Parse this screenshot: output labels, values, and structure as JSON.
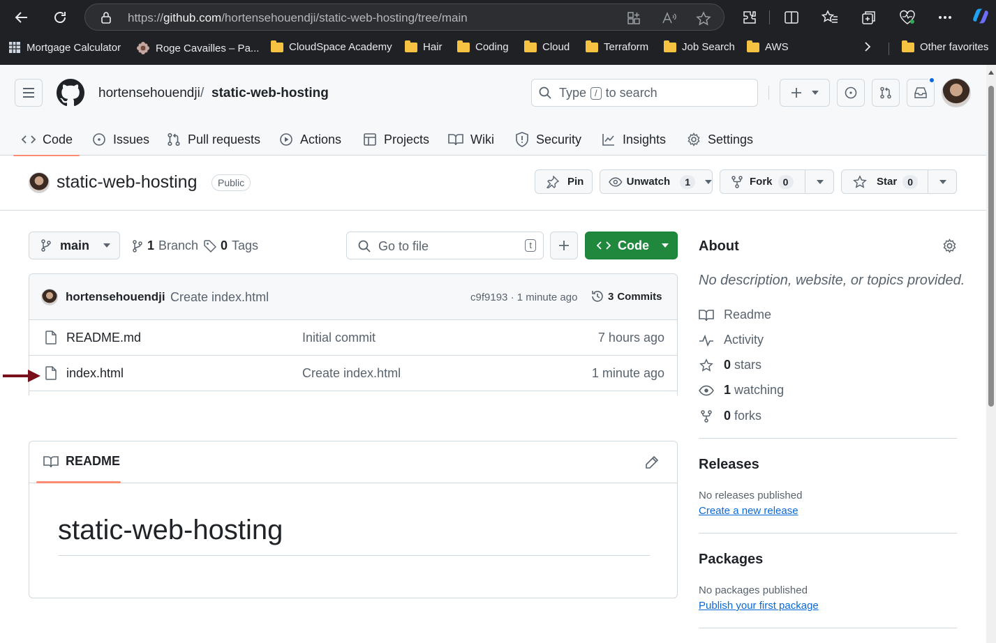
{
  "browser": {
    "url_prefix": "https://",
    "url_host": "github.com",
    "url_path": "/hortensehouendji/static-web-hosting/tree/main",
    "bookmarks": [
      {
        "label": "Mortgage Calculator",
        "icon": "grid-icon"
      },
      {
        "label": "Roge Cavailles – Pa...",
        "icon": "flower-icon"
      },
      {
        "label": "CloudSpace Academy",
        "icon": "folder-icon"
      },
      {
        "label": "Hair",
        "icon": "folder-icon"
      },
      {
        "label": "Coding",
        "icon": "folder-icon"
      },
      {
        "label": "Cloud",
        "icon": "folder-icon"
      },
      {
        "label": "Terraform",
        "icon": "folder-icon"
      },
      {
        "label": "Job Search",
        "icon": "folder-icon"
      },
      {
        "label": "AWS",
        "icon": "folder-icon"
      }
    ],
    "other_favorites": "Other favorites"
  },
  "header": {
    "owner": "hortensehouendji",
    "separator": "/",
    "repo": "static-web-hosting",
    "search": {
      "prefix": "Type",
      "key": "/",
      "suffix": "to search"
    }
  },
  "tabs": [
    {
      "label": "Code",
      "icon": "code-icon",
      "active": true
    },
    {
      "label": "Issues",
      "icon": "issue-icon"
    },
    {
      "label": "Pull requests",
      "icon": "pull-request-icon"
    },
    {
      "label": "Actions",
      "icon": "play-icon"
    },
    {
      "label": "Projects",
      "icon": "table-icon"
    },
    {
      "label": "Wiki",
      "icon": "book-icon"
    },
    {
      "label": "Security",
      "icon": "shield-icon"
    },
    {
      "label": "Insights",
      "icon": "graph-icon"
    },
    {
      "label": "Settings",
      "icon": "gear-icon"
    }
  ],
  "repo": {
    "name": "static-web-hosting",
    "visibility": "Public",
    "pin_label": "Pin",
    "unwatch_label": "Unwatch",
    "watch_count": "1",
    "fork_label": "Fork",
    "fork_count": "0",
    "star_label": "Star",
    "star_count": "0"
  },
  "browser_bar": {
    "branch": "main",
    "branch_count": "1",
    "branch_label": "Branch",
    "tag_count": "0",
    "tag_label": "Tags",
    "goto_placeholder": "Go to file",
    "goto_key": "t",
    "code_label": "Code"
  },
  "last_commit": {
    "author": "hortensehouendji",
    "message": "Create index.html",
    "sha": "c9f9193",
    "dot": "·",
    "age": "1 minute ago",
    "commits_count": "3",
    "commits_label": "Commits"
  },
  "files": [
    {
      "name": "README.md",
      "message": "Initial commit",
      "age": "7 hours ago"
    },
    {
      "name": "index.html",
      "message": "Create index.html",
      "age": "1 minute ago"
    }
  ],
  "readme": {
    "tab_label": "README",
    "heading": "static-web-hosting"
  },
  "about": {
    "title": "About",
    "description": "No description, website, or topics provided.",
    "items": [
      {
        "icon": "book-icon",
        "count": "",
        "label": "Readme"
      },
      {
        "icon": "pulse-icon",
        "count": "",
        "label": "Activity"
      },
      {
        "icon": "star-icon",
        "count": "0",
        "label": "stars"
      },
      {
        "icon": "eye-icon",
        "count": "1",
        "label": "watching"
      },
      {
        "icon": "fork-icon",
        "count": "0",
        "label": "forks"
      }
    ]
  },
  "releases": {
    "title": "Releases",
    "empty": "No releases published",
    "link": "Create a new release"
  },
  "packages": {
    "title": "Packages",
    "empty": "No packages published",
    "link": "Publish your first package"
  },
  "colors": {
    "accent_green": "#1f883d",
    "tab_underline": "#fd8c73",
    "link_blue": "#0969da",
    "annotation_arrow": "#7a0f1c"
  }
}
